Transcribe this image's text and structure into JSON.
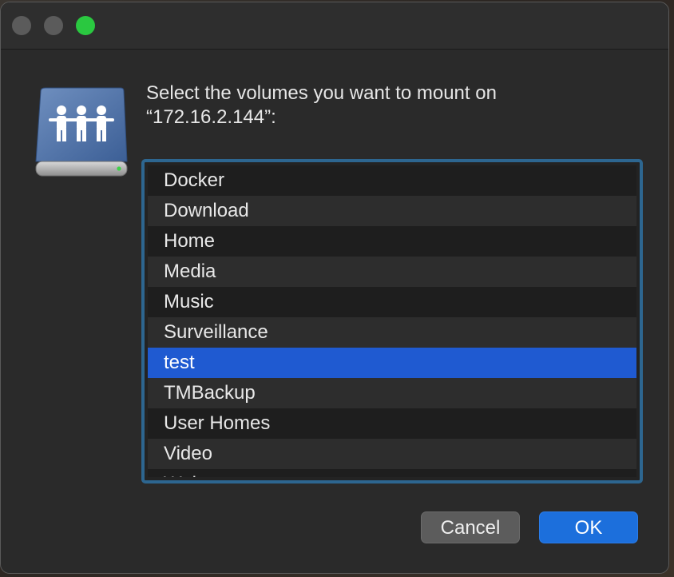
{
  "window": {
    "traffic_lights": [
      "close",
      "minimize",
      "zoom"
    ]
  },
  "icon": {
    "name": "network-share-drive-icon"
  },
  "prompt": {
    "line1": "Select the volumes you want to mount on",
    "line2": "“172.16.2.144”:"
  },
  "volumes": {
    "items": [
      "Docker",
      "Download",
      "Home",
      "Media",
      "Music",
      "Surveillance",
      "test",
      "TMBackup",
      "User Homes",
      "Video",
      "Web"
    ],
    "selected": "test"
  },
  "buttons": {
    "cancel": "Cancel",
    "ok": "OK"
  },
  "colors": {
    "selection": "#1f5ad1",
    "focus_ring": "#2d6690",
    "default_button": "#1c6fdc",
    "zoom": "#2ac840"
  }
}
